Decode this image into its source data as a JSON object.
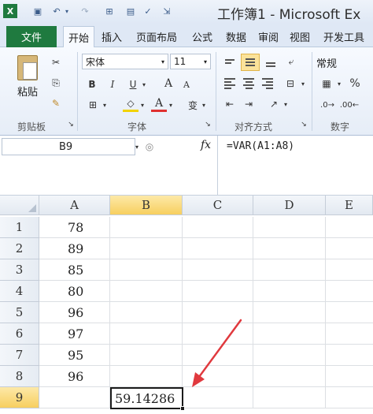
{
  "window": {
    "title": "工作簿1 - Microsoft Ex"
  },
  "tabs": [
    "文件",
    "开始",
    "插入",
    "页面布局",
    "公式",
    "数据",
    "审阅",
    "视图",
    "开发工具"
  ],
  "ribbon": {
    "paste_label": "粘贴",
    "font_name": "宋体",
    "font_size": "11",
    "number_format": "常规",
    "groups": {
      "clipboard": "剪贴板",
      "font": "字体",
      "alignment": "对齐方式",
      "number": "数字"
    },
    "bold": "B",
    "italic": "I",
    "underline": "U",
    "grow_font": "A",
    "shrink_font": "A",
    "font_color_letter": "A",
    "phonetic": "变",
    "percent": "%"
  },
  "formula_bar": {
    "name_box": "B9",
    "fx": "fx",
    "formula": "=VAR(A1:A8)"
  },
  "sheet": {
    "columns": [
      "A",
      "B",
      "C",
      "D",
      "E"
    ],
    "rows": [
      "1",
      "2",
      "3",
      "4",
      "5",
      "6",
      "7",
      "8",
      "9"
    ],
    "col_a_values": [
      "78",
      "89",
      "85",
      "80",
      "96",
      "97",
      "95",
      "96",
      ""
    ],
    "b9_value": "59.14286",
    "active_cell": "B9"
  },
  "colors": {
    "file_tab": "#1f7a3f",
    "active_header": "#f7cf5f",
    "annotation_arrow": "#e0393e"
  }
}
